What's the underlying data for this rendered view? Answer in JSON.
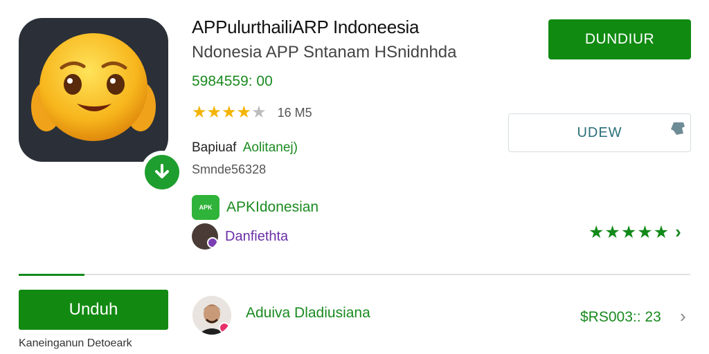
{
  "app": {
    "title": "APPulurthailiARP Indoneesia",
    "subtitle": "Ndonesia APP Sntanam HSnidnhda",
    "price": "5984559: 00",
    "rating": 4,
    "rating_max": 5,
    "size": "16 M5",
    "category_label": "Bapiuaf",
    "category_sub": "Aolitanej)",
    "version": "Smnde56328"
  },
  "developers": [
    {
      "logo_text": "APK",
      "name": "APKIdonesian"
    },
    {
      "name": "Danfiethta"
    }
  ],
  "buttons": {
    "download": "DUNDIUR",
    "review": "UDEW",
    "unduh": "Unduh"
  },
  "footer": {
    "label": "Kaneinganun Detoeark"
  },
  "review": {
    "name": "Aduiva Dladiusiana",
    "price": "$RS003:: 23"
  },
  "colors": {
    "accent_green": "#128a12",
    "star_yellow": "#f3b400"
  },
  "icons": [
    "emoji-face-icon",
    "download-badge-icon",
    "star-icon",
    "chevron-right-icon",
    "tablet-icon"
  ]
}
